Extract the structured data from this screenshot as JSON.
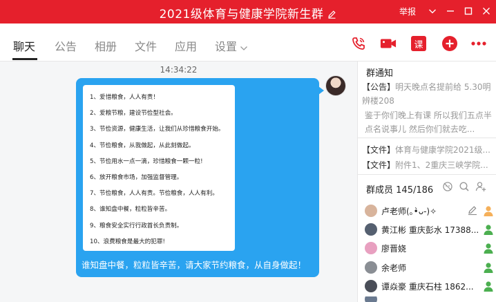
{
  "window": {
    "title": "2021级体育与健康学院新生群",
    "report_label": "举报"
  },
  "tabs": [
    {
      "label": "聊天",
      "active": true
    },
    {
      "label": "公告"
    },
    {
      "label": "相册"
    },
    {
      "label": "文件"
    },
    {
      "label": "应用"
    },
    {
      "label": "设置"
    }
  ],
  "toolbar": {
    "course_label": "课"
  },
  "chat": {
    "timestamp": "14:34:22",
    "card_lines": [
      "1、爱惜粮食，人人有责！",
      "2、爱粮节粮，建设节俭型社会。",
      "3、节俭资源，健康生活，让我们从珍惜粮食开始。",
      "4、节俭粮食，从我做起，从此刻做起。",
      "5、节俭用水一点一滴，珍惜粮食一颗一粒!",
      "6、放开粮食市场，加强监督管理。",
      "7、节俭粮食，人人有责。节俭粮食，人人有利。",
      "8、谁知盘中餐，粒粒皆辛苦。",
      "9、粮食安全实行行政首长负责制。",
      "10、浪费粮食是最大的犯罪!"
    ],
    "message_text": "谁知盘中餐，粒粒皆辛苦，请大家节约粮食，从自身做起！"
  },
  "sidebar": {
    "notice_title": "群通知",
    "notice_tag": "【公告】",
    "notice_text": "明天晚点名提前给 5.30明辨楼208",
    "notice_text2": "鉴于你们晚上有课 所以我们五点半点名说事儿 然后你们就去吃...",
    "files": [
      {
        "tag": "【文件】",
        "name": "体育与健康学院2021级..."
      },
      {
        "tag": "【文件】",
        "name": "附件1、2重庆三峡学院..."
      }
    ],
    "members_label": "群成员",
    "members_count": "145/186",
    "members": [
      {
        "name": "卢老师(｡•̀ᴗ-)✧",
        "avatar_color": "#d8b49c"
      },
      {
        "name": "黄江彬 重庆彭水 17388...",
        "avatar_color": "#556070"
      },
      {
        "name": "廖晋娆",
        "avatar_color": "#e8a0c0"
      },
      {
        "name": "余老师",
        "avatar_color": "#8a8e94"
      },
      {
        "name": "谭焱豪 重庆石柱 1862...",
        "avatar_color": "#4a4e58"
      }
    ]
  },
  "colors": {
    "brand_red": "#e5202c",
    "bubble_blue": "#2aa3f0",
    "member_green": "#4caf50"
  }
}
